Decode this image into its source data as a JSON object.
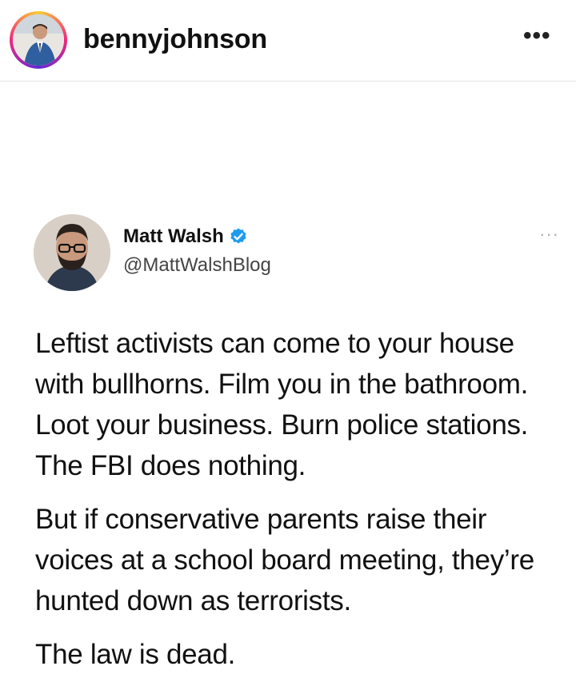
{
  "instagram_header": {
    "username": "bennyjohnson",
    "more_label": "•••"
  },
  "tweet": {
    "author_name": "Matt Walsh",
    "author_handle": "@MattWalshBlog",
    "verified": true,
    "more_label": "···",
    "paragraphs": [
      "Leftist activists can come to your house with bullhorns. Film you in the bathroom. Loot your business. Burn police stations. The FBI does nothing.",
      "But if conservative parents raise their voices at a school board meeting, they’re hunted down as terrorists.",
      "The law is dead."
    ]
  },
  "colors": {
    "verified_badge": "#1d9bf0",
    "divider": "#e4e4e4"
  }
}
